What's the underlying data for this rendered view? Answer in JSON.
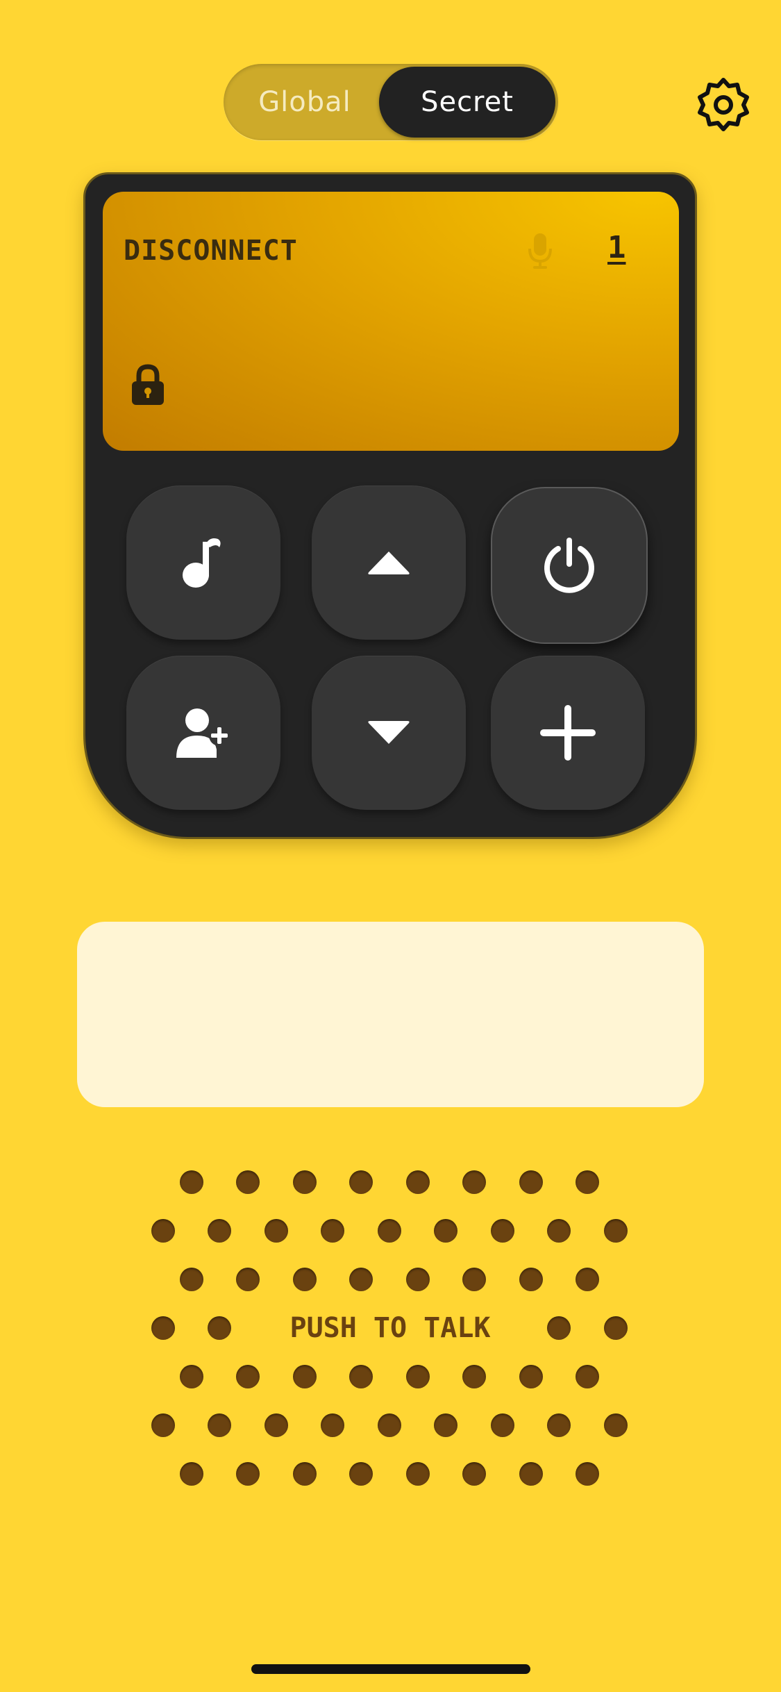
{
  "toggle": {
    "options": [
      "Global",
      "Secret"
    ],
    "selected": "Secret"
  },
  "settings": {
    "icon": "gear-icon"
  },
  "device": {
    "screen": {
      "status": "DISCONNECT",
      "channel": "1",
      "mic_icon": "microphone-icon",
      "lock_icon": "lock-icon",
      "mic_active": false,
      "locked": true
    },
    "buttons": [
      {
        "id": "music",
        "icon": "music-note-icon"
      },
      {
        "id": "channel-up",
        "icon": "caret-up-icon"
      },
      {
        "id": "power",
        "icon": "power-icon"
      },
      {
        "id": "add-friend",
        "icon": "add-user-icon"
      },
      {
        "id": "channel-down",
        "icon": "caret-down-icon"
      },
      {
        "id": "add",
        "icon": "plus-icon"
      }
    ]
  },
  "message_box": {
    "text": ""
  },
  "push_to_talk": {
    "label": "PUSH TO TALK"
  },
  "colors": {
    "background": "#FFD633",
    "device": "#232323",
    "screen": "#E2A300",
    "speaker_dot": "#6A4210",
    "message_box": "#FFF5D4"
  }
}
